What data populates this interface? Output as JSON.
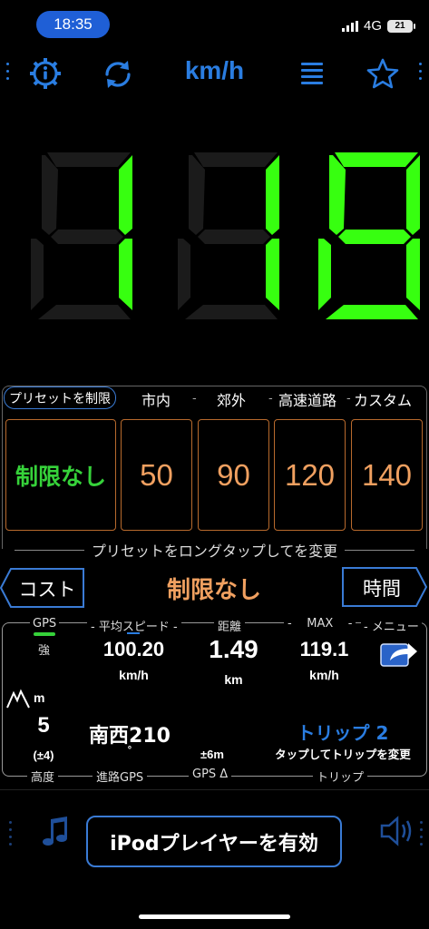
{
  "status_bar": {
    "time": "18:35",
    "network": "4G",
    "battery": "21"
  },
  "toolbar": {
    "unit": "km/h",
    "icons": [
      "info-gear-icon",
      "refresh-icon",
      "list-icon",
      "star-icon"
    ]
  },
  "speed": {
    "value": "118",
    "digit_color": "#37ff10"
  },
  "presets": {
    "headers": [
      "プリセットを制限",
      "市内",
      "郊外",
      "高速道路",
      "カスタム"
    ],
    "separator": "-",
    "values": [
      "制限なし",
      "50",
      "90",
      "120",
      "140"
    ],
    "hint": "プリセットをロングタップしてを変更"
  },
  "limit_row": {
    "cost_label": "コスト",
    "limit_text": "制限なし",
    "time_label": "時間"
  },
  "stats": {
    "gps_label": "GPS",
    "gps_strength": "強",
    "avg_speed_label": "平均スピード",
    "avg_speed_value": "100.20",
    "avg_speed_unit": "km/h",
    "distance_label": "距離",
    "distance_value": "1.49",
    "distance_unit": "km",
    "max_label": "MAX",
    "max_value": "119.1",
    "max_unit": "km/h",
    "menu_label": "メニュー",
    "altitude_unit": "m",
    "altitude_value": "5",
    "altitude_accuracy": "(±4)",
    "heading_value": "南西210",
    "heading_unit": "°",
    "gps_delta_value": "±6m",
    "trip_label": "トリップ 2",
    "trip_hint": "タップしてトリップを変更",
    "bottom_labels": [
      "高度",
      "進路GPS",
      "GPS Δ",
      "トリップ"
    ]
  },
  "bottom": {
    "ipod_button": "iPodプレイヤーを有効"
  }
}
